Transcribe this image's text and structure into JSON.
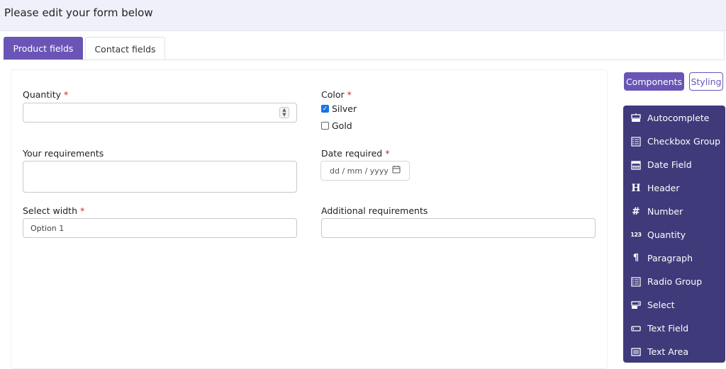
{
  "header": {
    "title": "Please edit your form below"
  },
  "tabs": [
    {
      "label": "Product fields",
      "active": true
    },
    {
      "label": "Contact fields",
      "active": false
    }
  ],
  "form": {
    "quantity": {
      "label": "Quantity",
      "required_mark": "*",
      "value": ""
    },
    "color": {
      "label": "Color",
      "required_mark": "*",
      "options": [
        {
          "label": "Silver",
          "checked": true
        },
        {
          "label": "Gold",
          "checked": false
        }
      ]
    },
    "requirements": {
      "label": "Your requirements",
      "value": ""
    },
    "date_required": {
      "label": "Date required",
      "required_mark": "*",
      "placeholder": "dd / mm / yyyy"
    },
    "select_width": {
      "label": "Select width",
      "required_mark": "*",
      "value": "Option 1"
    },
    "additional": {
      "label": "Additional requirements",
      "value": ""
    }
  },
  "side": {
    "components_label": "Components",
    "styling_label": "Styling",
    "components": [
      {
        "label": "Autocomplete",
        "icon": "autocomplete-icon"
      },
      {
        "label": "Checkbox Group",
        "icon": "checkbox-group-icon"
      },
      {
        "label": "Date Field",
        "icon": "calendar-icon"
      },
      {
        "label": "Header",
        "icon": "header-icon"
      },
      {
        "label": "Number",
        "icon": "hash-icon"
      },
      {
        "label": "Quantity",
        "icon": "numbers-icon"
      },
      {
        "label": "Paragraph",
        "icon": "pilcrow-icon"
      },
      {
        "label": "Radio Group",
        "icon": "radio-group-icon"
      },
      {
        "label": "Select",
        "icon": "select-icon"
      },
      {
        "label": "Text Field",
        "icon": "text-field-icon"
      },
      {
        "label": "Text Area",
        "icon": "text-area-icon"
      }
    ]
  },
  "colors": {
    "accent": "#6a55b7",
    "panel": "#3f3a7a",
    "checkbox": "#1a73e8"
  }
}
